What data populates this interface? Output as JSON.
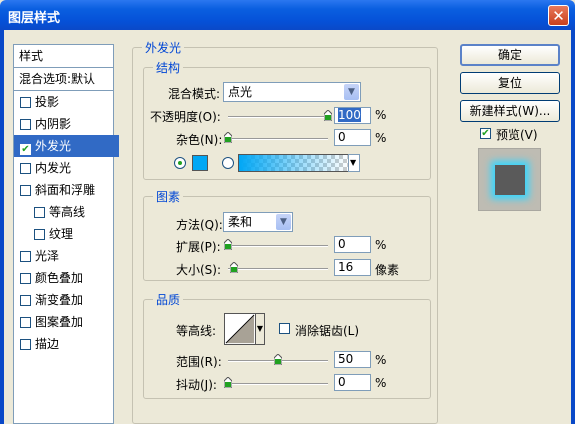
{
  "window": {
    "title": "图层样式",
    "close_glyph": "✕"
  },
  "style_list": {
    "header": "样式",
    "blend_options": "混合选项:默认",
    "items": [
      {
        "label": "投影",
        "checked": false
      },
      {
        "label": "内阴影",
        "checked": false
      },
      {
        "label": "外发光",
        "checked": true,
        "selected": true
      },
      {
        "label": "内发光",
        "checked": false
      },
      {
        "label": "斜面和浮雕",
        "checked": false
      },
      {
        "label": "等高线",
        "checked": false,
        "indent": true
      },
      {
        "label": "纹理",
        "checked": false,
        "indent": true
      },
      {
        "label": "光泽",
        "checked": false
      },
      {
        "label": "颜色叠加",
        "checked": false
      },
      {
        "label": "渐变叠加",
        "checked": false
      },
      {
        "label": "图案叠加",
        "checked": false
      },
      {
        "label": "描边",
        "checked": false
      }
    ]
  },
  "panel": {
    "title": "外发光",
    "structure": {
      "title": "结构",
      "blend_mode_label": "混合模式:",
      "blend_mode_value": "点光",
      "opacity_label": "不透明度(O):",
      "opacity_value": "100",
      "opacity_unit": "%",
      "opacity_level": 1.0,
      "noise_label": "杂色(N):",
      "noise_value": "0",
      "noise_unit": "%",
      "noise_level": 0.0,
      "glow_color": "#00a7f5",
      "solid_color_selected": true
    },
    "elements": {
      "title": "图素",
      "technique_label": "方法(Q):",
      "technique_value": "柔和",
      "spread_label": "扩展(P):",
      "spread_value": "0",
      "spread_unit": "%",
      "spread_level": 0.0,
      "size_label": "大小(S):",
      "size_value": "16",
      "size_unit": "像素",
      "size_level": 0.06
    },
    "quality": {
      "title": "品质",
      "contour_label": "等高线:",
      "antialias_label": "消除锯齿(L)",
      "antialias_checked": false,
      "range_label": "范围(R):",
      "range_value": "50",
      "range_unit": "%",
      "range_level": 0.5,
      "jitter_label": "抖动(J):",
      "jitter_value": "0",
      "jitter_unit": "%",
      "jitter_level": 0.0
    }
  },
  "buttons": {
    "ok": "确定",
    "reset": "复位",
    "new_style": "新建样式(W)...",
    "preview_label": "预览(V)",
    "preview_checked": true
  },
  "colors": {
    "title_bar": "#0a5fe0",
    "selection": "#316ac5",
    "accent_text": "#0046d5"
  }
}
